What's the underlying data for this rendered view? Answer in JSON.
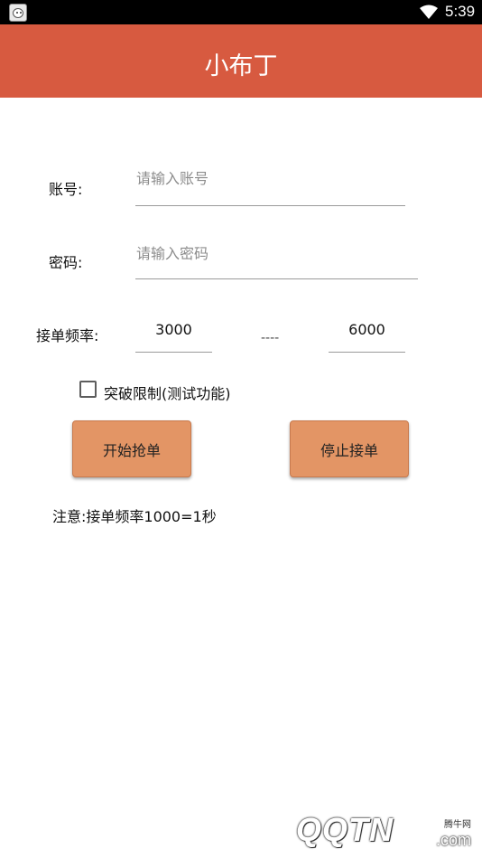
{
  "status_bar": {
    "time": "5:39",
    "icons": [
      "app-icon",
      "wifi-icon",
      "battery-icon"
    ]
  },
  "app_bar": {
    "title": "小布丁",
    "color": "#d75a40"
  },
  "form": {
    "account_label": "账号:",
    "account_placeholder": "请输入账号",
    "password_label": "密码:",
    "password_placeholder": "请输入密码",
    "frequency_label": "接单频率:",
    "frequency_min": "3000",
    "frequency_separator": "----",
    "frequency_max": "6000",
    "checkbox_label": "突破限制(测试功能)",
    "checkbox_checked": false
  },
  "buttons": {
    "start_label": "开始抢单",
    "stop_label": "停止接单",
    "color": "#e39565"
  },
  "note": "注意:接单频率1000=1秒",
  "watermark": {
    "logo_text": "QQTN",
    "small_text": "腾牛网",
    "suffix": ".com"
  }
}
